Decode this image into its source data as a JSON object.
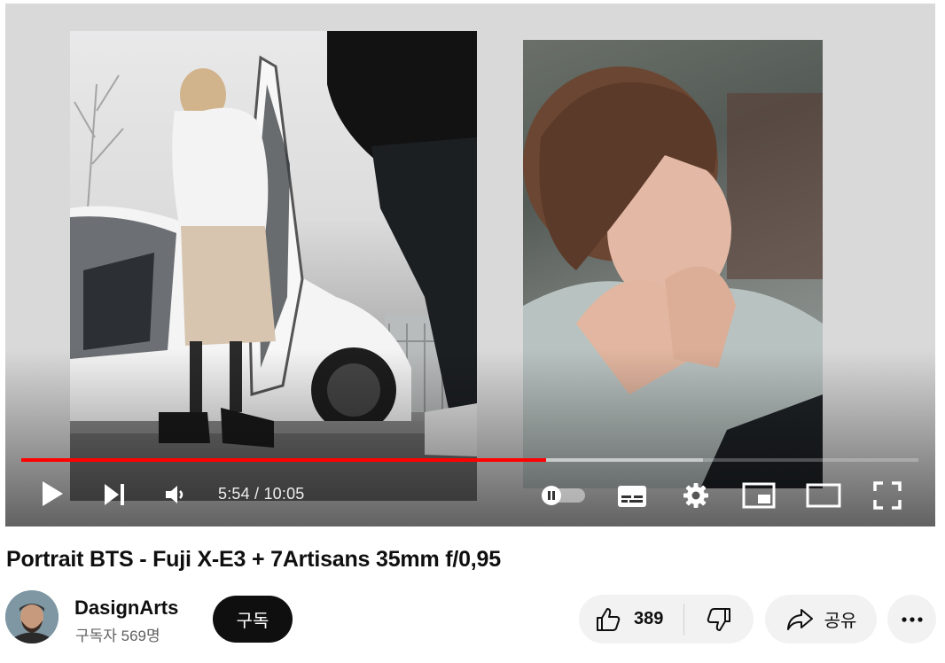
{
  "player": {
    "time_current": "5:54",
    "time_separator": " / ",
    "time_total": "10:05",
    "progress_played": 0.585,
    "progress_buffered": 0.76,
    "accent_color": "#ff0000",
    "controls": {
      "play": "play-icon",
      "next": "next-icon",
      "volume": "volume-icon",
      "autoplay": "autoplay-toggle-icon",
      "captions": "captions-icon",
      "settings": "gear-icon",
      "miniplayer": "miniplayer-icon",
      "theater": "theater-mode-icon",
      "fullscreen": "fullscreen-icon"
    }
  },
  "video": {
    "title": "Portrait BTS - Fuji X-E3 + 7Artisans 35mm f/0,95"
  },
  "channel": {
    "name": "DasignArts",
    "subscribers": "구독자 569명",
    "subscribe_label": "구독"
  },
  "actions": {
    "like_count": "389",
    "share_label": "공유"
  }
}
